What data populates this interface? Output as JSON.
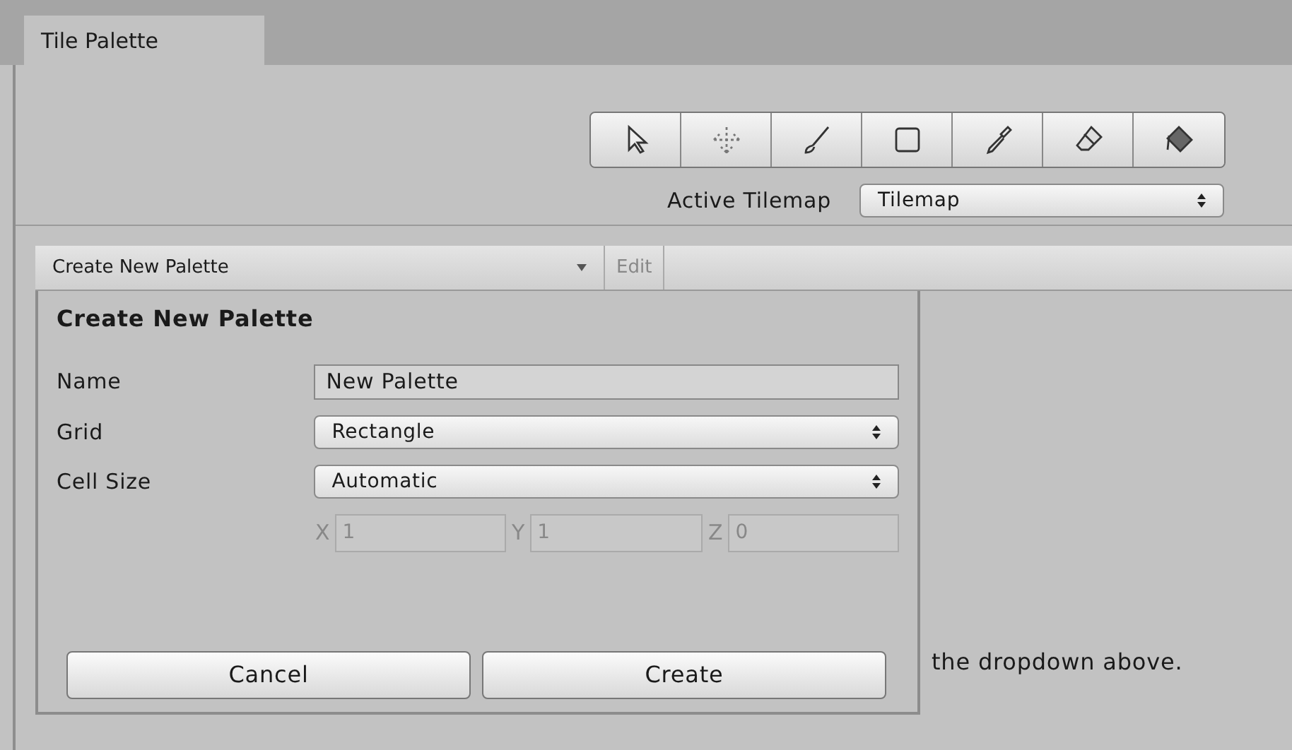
{
  "window": {
    "tab": "Tile Palette"
  },
  "active_tilemap": {
    "label": "Active Tilemap",
    "value": "Tilemap"
  },
  "palette_bar": {
    "dropdown": "Create New Palette",
    "edit": "Edit",
    "edit_disabled": true
  },
  "popup": {
    "title": "Create New Palette",
    "fields": [
      {
        "kind": "text",
        "label": "Name",
        "value": "New Palette"
      },
      {
        "kind": "select",
        "label": "Grid",
        "value": "Rectangle"
      },
      {
        "kind": "select",
        "label": "Cell Size",
        "value": "Automatic"
      }
    ],
    "cell_size": [
      {
        "axis": "X",
        "value": "1",
        "disabled": true
      },
      {
        "axis": "Y",
        "value": "1",
        "disabled": true
      },
      {
        "axis": "Z",
        "value": "0",
        "disabled": true
      }
    ],
    "buttons": [
      "Cancel",
      "Create"
    ]
  },
  "hint": "the dropdown above."
}
